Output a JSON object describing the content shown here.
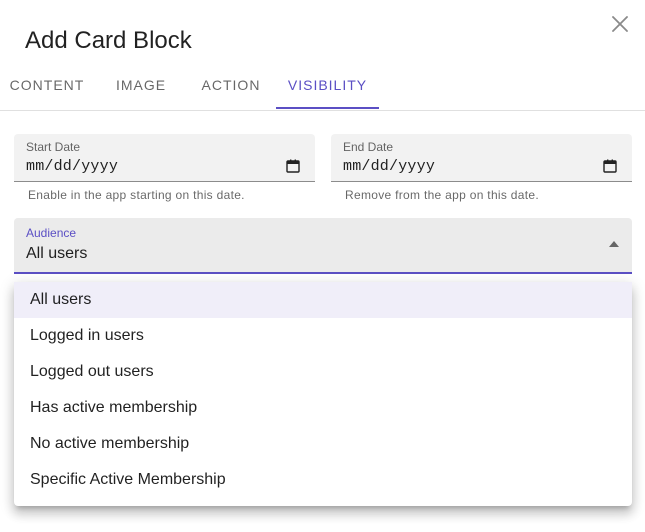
{
  "dialog": {
    "title": "Add Card Block"
  },
  "tabs": [
    {
      "label": "CONTENT"
    },
    {
      "label": "IMAGE"
    },
    {
      "label": "ACTION"
    },
    {
      "label": "VISIBILITY"
    }
  ],
  "active_tab": "VISIBILITY",
  "start_date": {
    "label": "Start Date",
    "value": "mm/dd/yyyy",
    "helper": "Enable in the app starting on this date."
  },
  "end_date": {
    "label": "End Date",
    "value": "mm/dd/yyyy",
    "helper": "Remove from the app on this date."
  },
  "audience": {
    "label": "Audience",
    "value": "All users",
    "options": [
      "All users",
      "Logged in users",
      "Logged out users",
      "Has active membership",
      "No active membership",
      "Specific Active Membership"
    ]
  },
  "icons": {
    "close": "close-icon",
    "calendar": "calendar-icon",
    "dropdown": "arrow-drop-up-icon"
  },
  "colors": {
    "accent": "#5b4fc4",
    "field_bg": "#f2f2f2",
    "selected_bg": "#f0eef9"
  }
}
